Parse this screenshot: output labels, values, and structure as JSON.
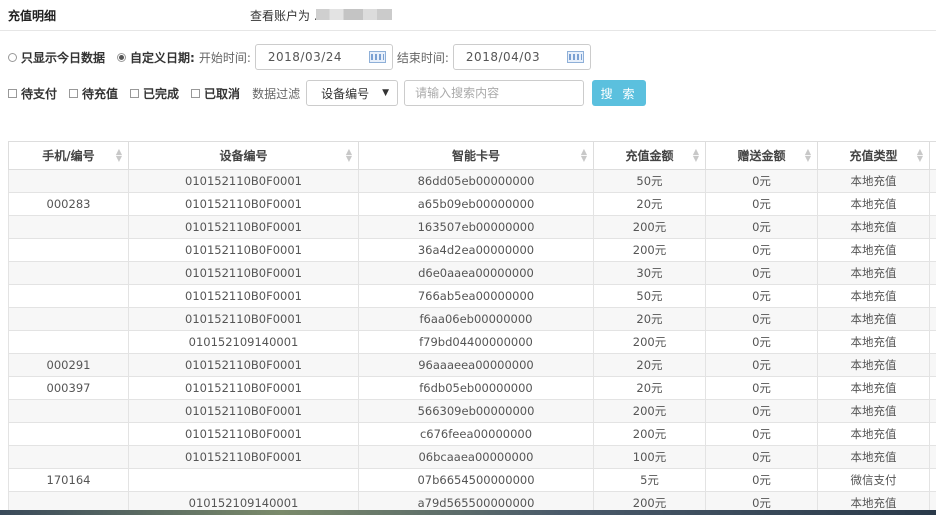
{
  "header": {
    "title": "充值明细",
    "account_label": "查看账户为 ."
  },
  "filters": {
    "today_only_label": "只显示今日数据",
    "custom_date_label": "自定义日期:",
    "start_label": "开始时间:",
    "start_value": "2018/03/24",
    "end_label": "结束时间:",
    "end_value": "2018/04/03",
    "status_options": [
      "待支付",
      "待充值",
      "已完成",
      "已取消"
    ],
    "data_filter_label": "数据过滤",
    "select_value": "设备编号",
    "search_placeholder": "请输入搜索内容",
    "search_button": "搜 索"
  },
  "table": {
    "columns": [
      "手机/编号",
      "设备编号",
      "智能卡号",
      "充值金额",
      "赠送金额",
      "充值类型"
    ],
    "rows": [
      [
        "",
        "010152110B0F0001",
        "86dd05eb00000000",
        "50元",
        "0元",
        "本地充值"
      ],
      [
        "000283",
        "010152110B0F0001",
        "a65b09eb00000000",
        "20元",
        "0元",
        "本地充值"
      ],
      [
        "",
        "010152110B0F0001",
        "163507eb00000000",
        "200元",
        "0元",
        "本地充值"
      ],
      [
        "",
        "010152110B0F0001",
        "36a4d2ea00000000",
        "200元",
        "0元",
        "本地充值"
      ],
      [
        "",
        "010152110B0F0001",
        "d6e0aaea00000000",
        "30元",
        "0元",
        "本地充值"
      ],
      [
        "",
        "010152110B0F0001",
        "766ab5ea00000000",
        "50元",
        "0元",
        "本地充值"
      ],
      [
        "",
        "010152110B0F0001",
        "f6aa06eb00000000",
        "20元",
        "0元",
        "本地充值"
      ],
      [
        "",
        "010152109140001",
        "f79bd04400000000",
        "200元",
        "0元",
        "本地充值"
      ],
      [
        "000291",
        "010152110B0F0001",
        "96aaaeea00000000",
        "20元",
        "0元",
        "本地充值"
      ],
      [
        "000397",
        "010152110B0F0001",
        "f6db05eb00000000",
        "20元",
        "0元",
        "本地充值"
      ],
      [
        "",
        "010152110B0F0001",
        "566309eb00000000",
        "200元",
        "0元",
        "本地充值"
      ],
      [
        "",
        "010152110B0F0001",
        "c676feea00000000",
        "200元",
        "0元",
        "本地充值"
      ],
      [
        "",
        "010152110B0F0001",
        "06bcaaea00000000",
        "100元",
        "0元",
        "本地充值"
      ],
      [
        "170164",
        "",
        "07b6654500000000",
        "5元",
        "0元",
        "微信支付"
      ],
      [
        "",
        "010152109140001",
        "a79d565500000000",
        "200元",
        "0元",
        "本地充值"
      ]
    ]
  }
}
